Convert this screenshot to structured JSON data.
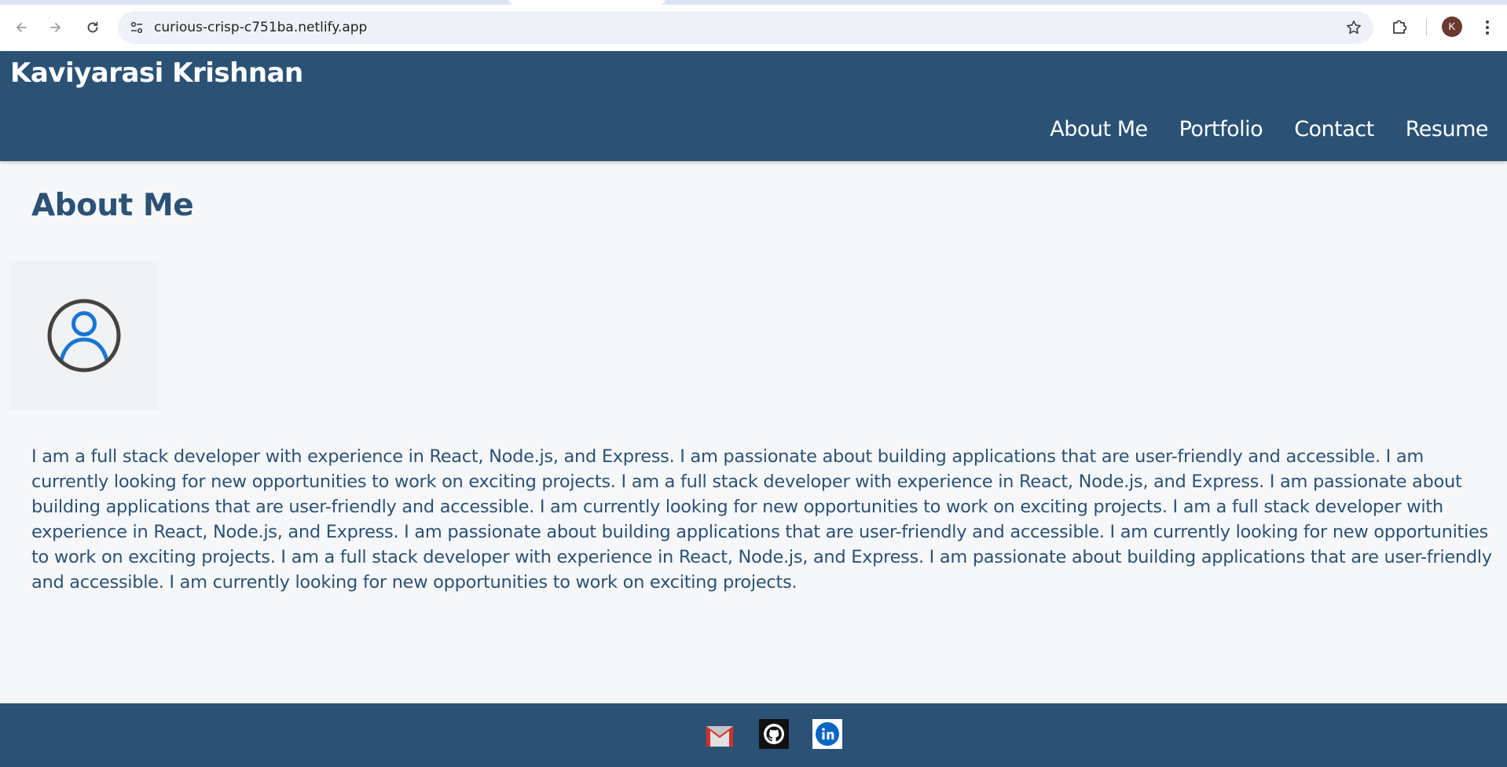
{
  "browser": {
    "url": "curious-crisp-c751ba.netlify.app",
    "profile_initial": "K",
    "icons": [
      "back-arrow-icon",
      "forward-arrow-icon",
      "reload-icon",
      "site-settings-icon",
      "bookmark-star-icon",
      "extensions-icon",
      "more-menu-icon"
    ]
  },
  "header": {
    "brand": "Kaviyarasi Krishnan",
    "nav": [
      "About Me",
      "Portfolio",
      "Contact",
      "Resume"
    ]
  },
  "main": {
    "title": "About Me",
    "bio": "I am a full stack developer with experience in React, Node.js, and Express. I am passionate about building applications that are user-friendly and accessible. I am currently looking for new opportunities to work on exciting projects. I am a full stack developer with experience in React, Node.js, and Express. I am passionate about building applications that are user-friendly and accessible. I am currently looking for new opportunities to work on exciting projects. I am a full stack developer with experience in React, Node.js, and Express. I am passionate about building applications that are user-friendly and accessible. I am currently looking for new opportunities to work on exciting projects. I am a full stack developer with experience in React, Node.js, and Express. I am passionate about building applications that are user-friendly and accessible. I am currently looking for new opportunities to work on exciting projects."
  },
  "footer": {
    "social": [
      "gmail-icon",
      "github-icon",
      "linkedin-icon"
    ]
  },
  "colors": {
    "header_bg": "#2b5275",
    "page_bg": "#f6f7f9",
    "title_color": "#2b5275"
  }
}
